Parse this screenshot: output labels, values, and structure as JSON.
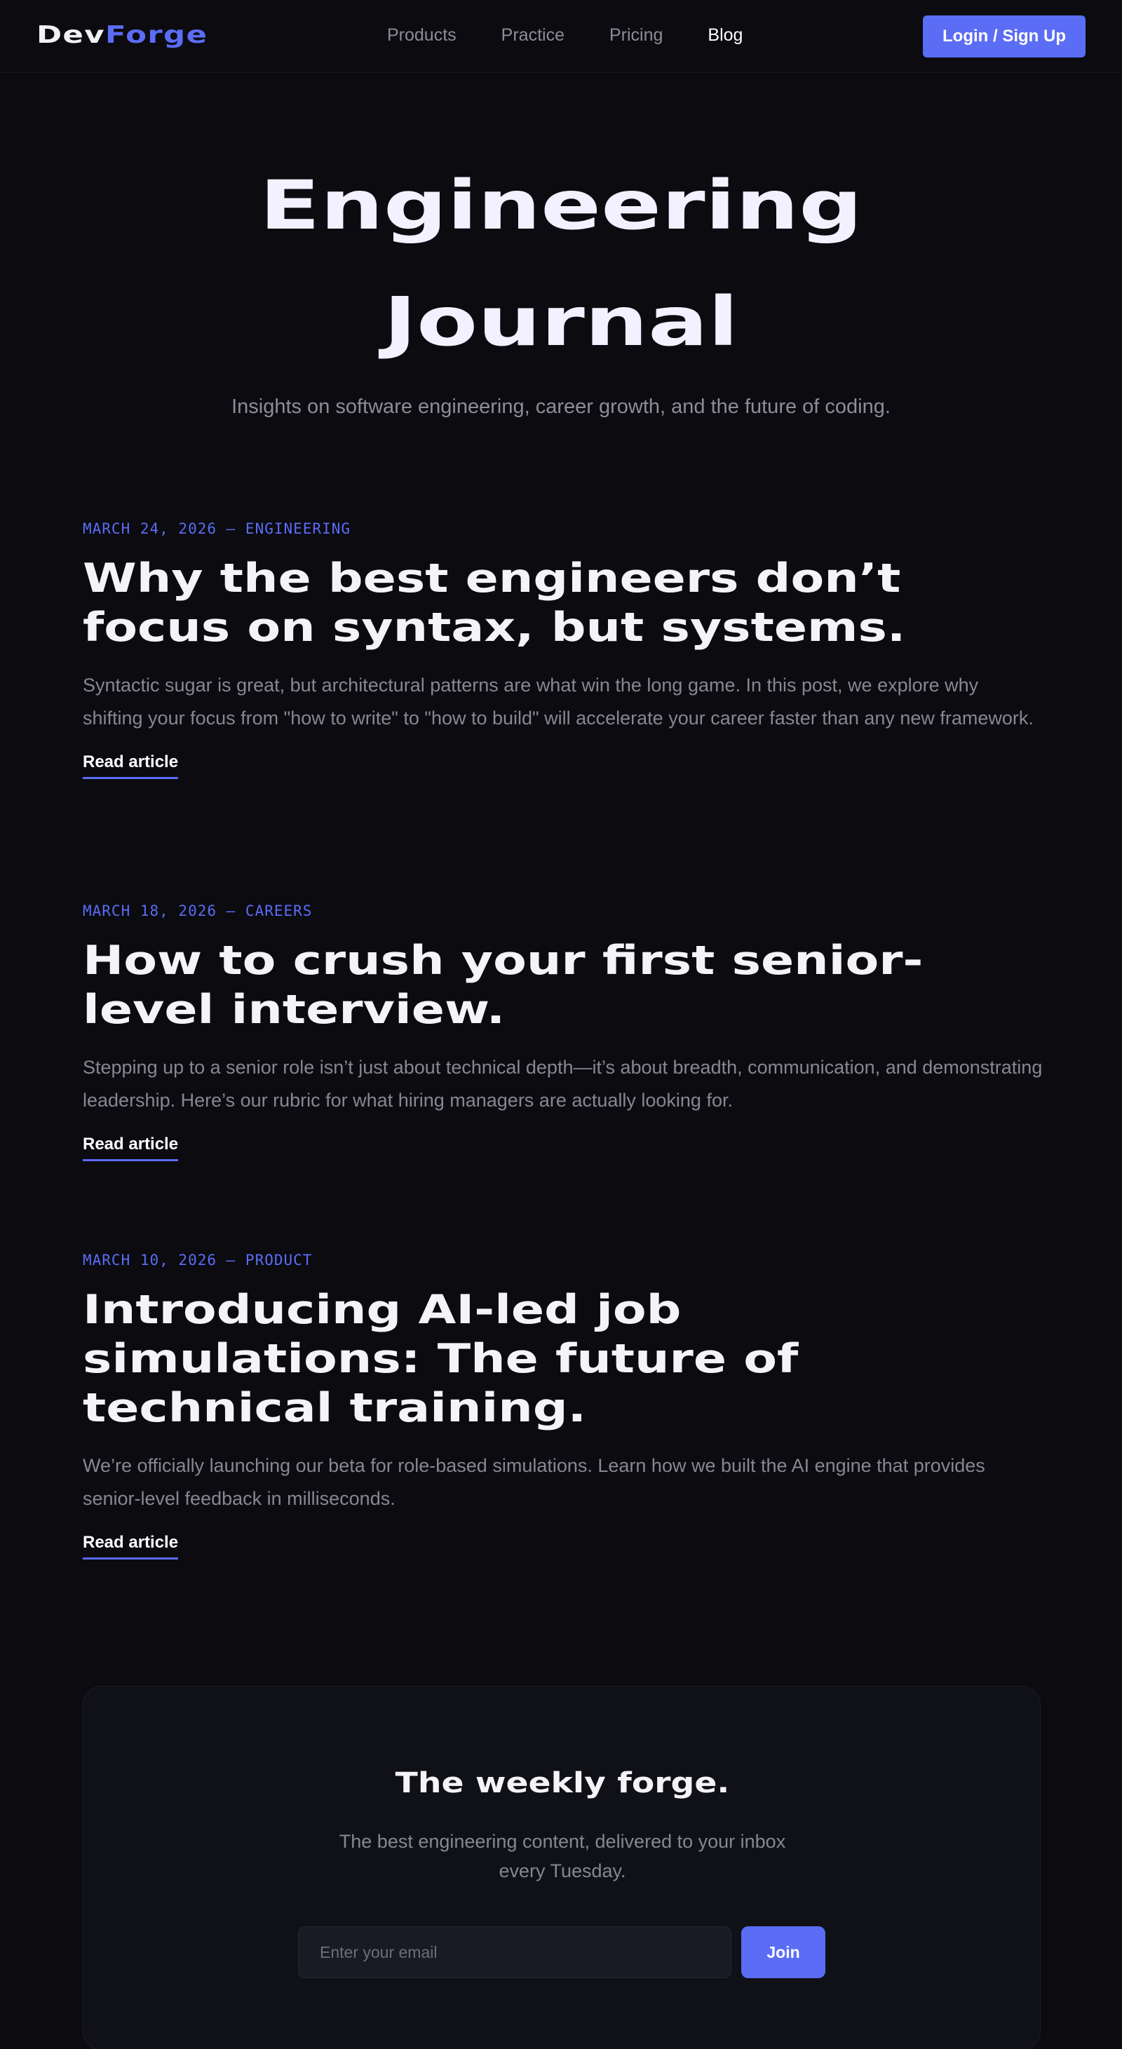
{
  "header": {
    "logo": {
      "part1": "Dev",
      "part2": "Forge"
    },
    "nav": [
      {
        "label": "Products",
        "active": false
      },
      {
        "label": "Practice",
        "active": false
      },
      {
        "label": "Pricing",
        "active": false
      },
      {
        "label": "Blog",
        "active": true
      }
    ],
    "login_label": "Login / Sign Up"
  },
  "hero": {
    "title_line1": "Engineering",
    "title_line2": "Journal",
    "subtitle": "Insights on software engineering, career growth, and the future of coding."
  },
  "articles": [
    {
      "meta": "MARCH 24, 2026 — ENGINEERING",
      "title": "Why the best engineers don’t focus on syntax, but systems.",
      "excerpt": "Syntactic sugar is great, but architectural patterns are what win the long game. In this post, we explore why shifting your focus from \"how to write\" to \"how to build\" will accelerate your career faster than any new framework.",
      "link_label": "Read article"
    },
    {
      "meta": "MARCH 18, 2026 — CAREERS",
      "title": "How to crush your first senior-level interview.",
      "excerpt": "Stepping up to a senior role isn’t just about technical depth—it’s about breadth, communication, and demonstrating leadership. Here’s our rubric for what hiring managers are actually looking for.",
      "link_label": "Read article"
    },
    {
      "meta": "MARCH 10, 2026 — PRODUCT",
      "title": "Introducing AI-led job simulations: The future of technical training.",
      "excerpt": "We’re officially launching our beta for role-based simulations. Learn how we built the AI engine that provides senior-level feedback in milliseconds.",
      "link_label": "Read article"
    }
  ],
  "newsletter": {
    "title": "The weekly forge.",
    "subtitle": "The best engineering content, delivered to your inbox every Tuesday.",
    "email_placeholder": "Enter your email",
    "email_value": "",
    "join_label": "Join"
  },
  "colors": {
    "background": "#0b0b10",
    "accent": "#5b6cf5",
    "text_primary": "#f4f4f8",
    "text_muted": "#878793",
    "card": "#101017"
  }
}
